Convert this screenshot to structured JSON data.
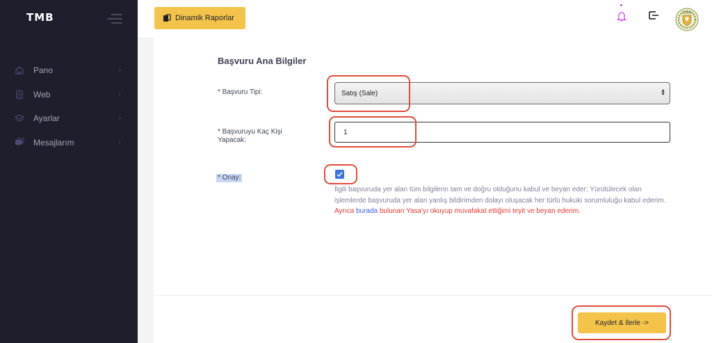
{
  "sidebar": {
    "brand": "TMB",
    "items": [
      {
        "label": "Pano",
        "icon": "home-icon"
      },
      {
        "label": "Web",
        "icon": "document-icon"
      },
      {
        "label": "Ayarlar",
        "icon": "layers-icon"
      },
      {
        "label": "Mesajlarım",
        "icon": "messages-icon"
      }
    ]
  },
  "header": {
    "report_button": "Dinamik Raporlar",
    "icons": [
      "bell-icon",
      "logout-icon",
      "emblem-logo"
    ]
  },
  "form": {
    "title": "Başvuru Ana Bilgiler",
    "application_type_label": "* Başvuru Tipi:",
    "application_type_value": "Satış (Sale)",
    "person_count_label": "* Başvuruyu Kaç Kişi Yapacak:",
    "person_count_value": "1",
    "consent_label": "* Onay:",
    "consent_checked": true,
    "consent_text_1": "İlgili başvuruda yer alan tüm bilgilerin tam ve doğru olduğunu kabul ve beyan eder; Yürütülecek olan işlemlerde başvuruda yer alan yanlış bildirimden dolayı oluşacak her türlü hukuki sorumluluğu kabul ederim.",
    "consent_text_red_1": "Ayrıca",
    "consent_text_link": "burada",
    "consent_text_red_2": "bulunan Yasa'yı okuyup muvafakat ettiğimi teyit ve beyan ederim."
  },
  "footer": {
    "save_button": "Kaydet & İlerle ->"
  },
  "colors": {
    "sidebar_bg": "#1e1e2d",
    "accent_yellow": "#f4c44a",
    "annotation_red": "#e04b3b",
    "checkbox_blue": "#3b73e3"
  }
}
